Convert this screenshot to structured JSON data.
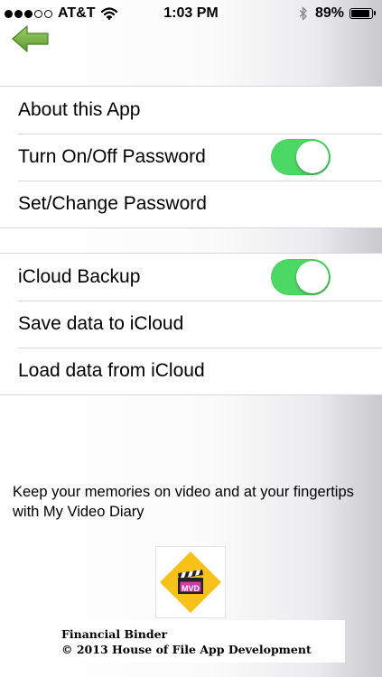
{
  "status_bar": {
    "signal_bars": [
      true,
      true,
      true,
      false,
      false
    ],
    "carrier": "AT&T",
    "wifi_icon": "wifi-icon",
    "time": "1:03 PM",
    "bluetooth_icon": "bluetooth-icon",
    "battery_percent_label": "89%",
    "battery_level": 0.89
  },
  "nav": {
    "back_icon": "back-arrow-icon",
    "back_color": "#7cb342"
  },
  "settings_group_1": [
    {
      "label": "About this App"
    },
    {
      "label": "Turn On/Off Password",
      "toggle_on": true
    },
    {
      "label": "Set/Change Password"
    }
  ],
  "settings_group_2": [
    {
      "label": "iCloud Backup",
      "toggle_on": true
    },
    {
      "label": "Save data to iCloud"
    },
    {
      "label": "Load data from iCloud"
    }
  ],
  "colors": {
    "toggle_on": "#4cd864"
  },
  "promo": {
    "text": "Keep your memories on video and at your fingertips with My Video Diary",
    "logo_text": "MVD",
    "logo_icon": "clapperboard-icon"
  },
  "footer": {
    "app_name": "Financial Binder",
    "copyright": "© 2013 House of File App Development"
  }
}
